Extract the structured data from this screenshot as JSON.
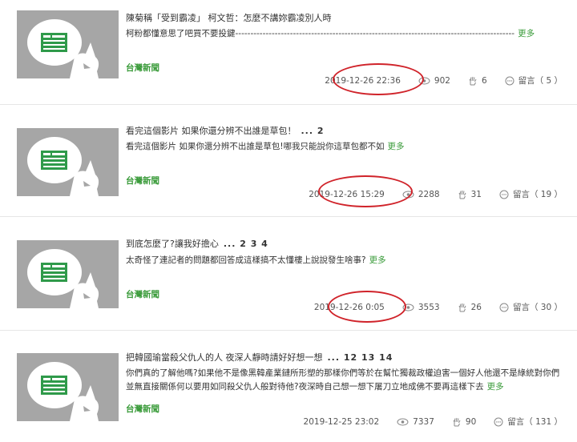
{
  "more_label": "更多",
  "comment_label": "留言",
  "posts": [
    {
      "title": "陳菊稱「受到霸凌」 柯文哲：怎麼不講妳霸凌別人時",
      "pages": "",
      "excerpt": "柯粉都懂意思了吧買不要投鍵--------------------------------------------------------------------------------------------",
      "source": "台灣新聞",
      "date": "2019-12-26 22:36",
      "views": "902",
      "likes": "6",
      "comments": "（ 5 ）",
      "date_circled": true
    },
    {
      "title": "看完這個影片 如果你還分辨不出誰是草包！",
      "pages": "... 2",
      "excerpt": "看完這個影片 如果你還分辨不出誰是草包!哪我只能說你這草包都不如",
      "source": "台灣新聞",
      "date": "2019-12-26 15:29",
      "views": "2288",
      "likes": "31",
      "comments": "（ 19 ）",
      "date_circled": true
    },
    {
      "title": "到底怎麼了?讓我好擔心",
      "pages": "... 2 3 4",
      "excerpt": "太奇怪了連記者的問題都回答成這樣搞不太懂樓上說說發生啥事?",
      "source": "台灣新聞",
      "date": "2019-12-26 0:05",
      "views": "3553",
      "likes": "26",
      "comments": "（ 30 ）",
      "date_circled": true
    },
    {
      "title": "把韓國瑜當殺父仇人的人 夜深人靜時請好好想一想",
      "pages": "... 12 13 14",
      "excerpt": "你們真的了解他嗎?如果他不是像黑韓產業鏈所形塑的那樣你們等於在幫忙獨裁政權迫害一個好人他還不是綠統對你們並無直接關係何以要用如同殺父仇人般對待他?夜深時自己想一想下屠刀立地成佛不要再這樣下去",
      "source": "台灣新聞",
      "date": "2019-12-25 23:02",
      "views": "7337",
      "likes": "90",
      "comments": "（ 131 ）",
      "date_circled": false
    }
  ]
}
